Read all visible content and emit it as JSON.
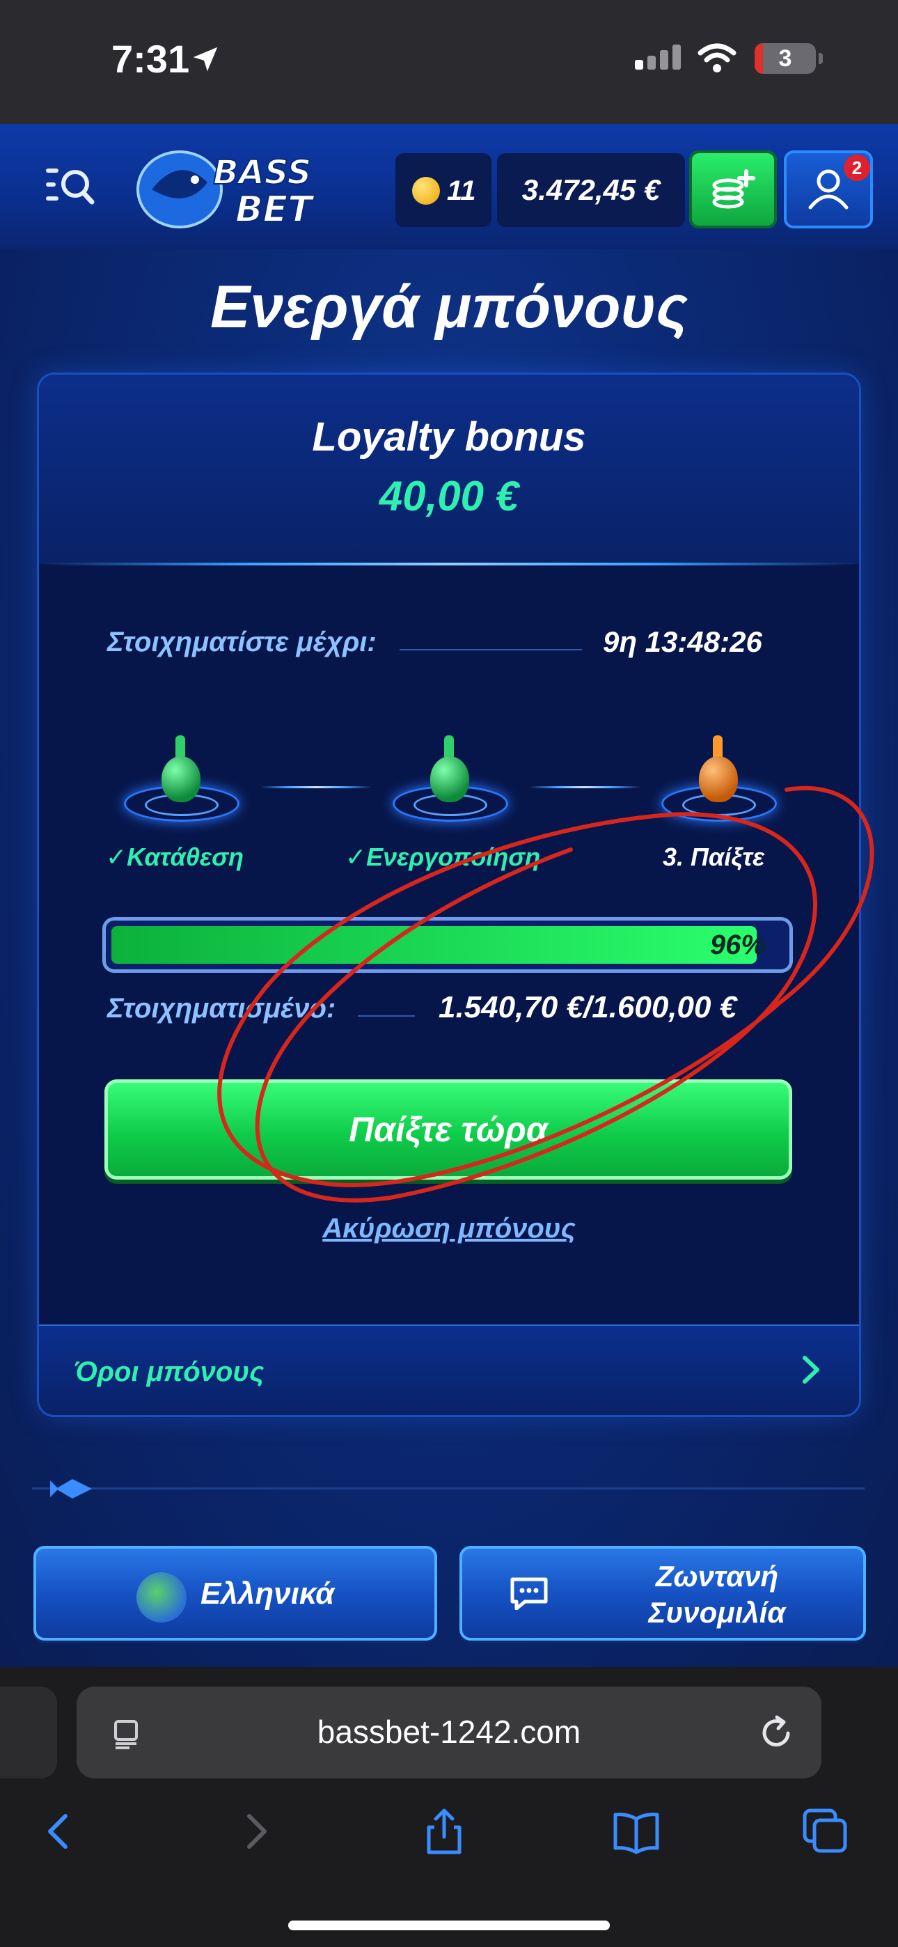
{
  "status_bar": {
    "time": "7:31",
    "battery_level": "3",
    "icons": [
      "location-arrow-icon",
      "signal-icon",
      "wifi-icon",
      "battery-icon"
    ]
  },
  "header": {
    "logo_line1": "BASS",
    "logo_line2": "BET",
    "coins": "11",
    "balance": "3.472,45 €",
    "notification_count": "2",
    "icons": [
      "menu-search-icon",
      "coin-icon",
      "deposit-coins-icon",
      "profile-icon"
    ]
  },
  "page": {
    "title": "Ενεργά μπόνους"
  },
  "bonus": {
    "name": "Loyalty bonus",
    "amount": "40,00 €",
    "wager_until_label": "Στοιχηματίστε μέχρι:",
    "wager_until_value": "9η 13:48:26",
    "steps": [
      {
        "label": "✓Κατάθεση",
        "state": "done"
      },
      {
        "label": "✓Ενεργοποίηση",
        "state": "done"
      },
      {
        "label": "3. Παίξτε",
        "state": "current"
      }
    ],
    "progress_percent": 96,
    "progress_label": "96%",
    "wagered_label": "Στοιχηματισμένο:",
    "wagered_value": "1.540,70 €/1.600,00 €",
    "play_button": "Παίξτε τώρα",
    "cancel_link": "Ακύρωση μπόνους",
    "terms_label": "Όροι μπόνους"
  },
  "footer": {
    "language_button": "Ελληνικά",
    "chat_button_line1": "Ζωντανή",
    "chat_button_line2": "Συνομιλία"
  },
  "browser": {
    "url": "bassbet-1242.com",
    "toolbar": [
      "back-icon",
      "forward-icon",
      "share-icon",
      "bookmarks-icon",
      "tabs-icon"
    ]
  },
  "colors": {
    "accent_green": "#2ff0b0",
    "button_green": "#0fcc4a",
    "background_blue": "#0b2a77",
    "annotation_red": "#d8261c"
  }
}
